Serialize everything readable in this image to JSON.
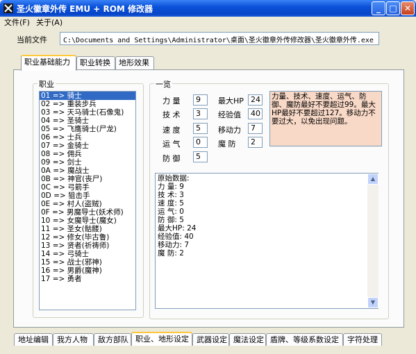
{
  "window": {
    "title": "圣火徽章外传 EMU + ROM 修改器"
  },
  "menu": [
    "文件(F)",
    "关于(A)"
  ],
  "current_file": {
    "label": "当前文件",
    "value": "C:\\Documents and Settings\\Administrator\\桌面\\圣火徽章外传修改器\\圣火徽章外传.exe"
  },
  "inner_tabs": [
    "职业基础能力",
    "职业转换",
    "地形效果"
  ],
  "class_group": {
    "title": "职业",
    "items": [
      "01 => 骑士",
      "02 => 重装步兵",
      "03 => 天马骑士(石像鬼)",
      "04 => 圣骑士",
      "05 => 飞鹰骑士(尸龙)",
      "06 => 士兵",
      "07 => 金骑士",
      "08 => 佣兵",
      "09 => 剑士",
      "0A => 魔战士",
      "0B => 神官(丧尸)",
      "0C => 弓箭手",
      "0D => 狙击手",
      "0E => 村人(盗贼)",
      "0F => 男魔导士(妖术师)",
      "10 => 女魔导士(魔女)",
      "11 => 圣女(骷髅)",
      "12 => 修女(毕古鲁)",
      "13 => 贤者(祈祷师)",
      "14 => 弓骑士",
      "15 => 战士(邪神)",
      "16 => 男爵(魔神)",
      "17 => 勇者"
    ],
    "selected_index": 0
  },
  "overview_group": {
    "title": "一览",
    "stats": {
      "power": {
        "label": "力 量",
        "value": "9"
      },
      "skill": {
        "label": "技 术",
        "value": "3"
      },
      "speed": {
        "label": "速 度",
        "value": "5"
      },
      "luck": {
        "label": "运 气",
        "value": "0"
      },
      "defense": {
        "label": "防 御",
        "value": "5"
      },
      "max_hp": {
        "label": "最大HP",
        "value": "24"
      },
      "exp": {
        "label": "经验值",
        "value": "40"
      },
      "move": {
        "label": "移动力",
        "value": "7"
      },
      "magic_def": {
        "label": "魔 防",
        "value": "2"
      }
    },
    "note": "力量、技术、速度、运气、防御、魔防最好不要超过99。最大HP最好不要超过127。移动力不要过大，以免出现问题。",
    "raw_data": [
      "原始数据:",
      "力 量: 9",
      "技 术: 3",
      "速 度: 5",
      "运 气: 0",
      "防 御: 5",
      "最大HP: 24",
      "经验值: 40",
      "移动力: 7",
      "魔 防: 2"
    ]
  },
  "bottom_tabs": [
    "地址编辑",
    "我方人物",
    "敌方部队",
    "职业、地形设定",
    "武器设定",
    "魔法设定",
    "盾牌、等级系数设定",
    "字符处理"
  ],
  "bottom_tab_active": 3,
  "colors": {
    "titlebar": "#0a52d9",
    "selection": "#316ac5",
    "note_bg": "#f8d8c6",
    "tab_highlight": "#ffc83c"
  }
}
